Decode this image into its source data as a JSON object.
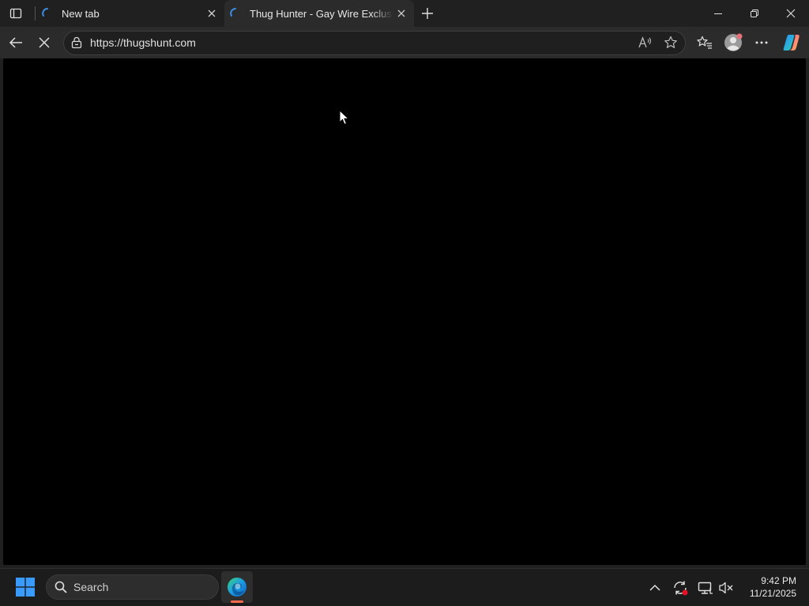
{
  "browser": {
    "tabs": [
      {
        "label": "New tab",
        "state": "loading"
      },
      {
        "label": "Thug Hunter - Gay Wire Exclusive",
        "state": "loading",
        "active": true
      }
    ],
    "address_bar": {
      "url": "https://thugshunt.com"
    },
    "icons": {
      "tab_actions": "tab-actions-icon",
      "back": "back-arrow-icon",
      "stop": "stop-loading-icon",
      "lock": "lock-icon",
      "read_aloud": "read-aloud-icon",
      "favorite": "star-icon",
      "favorites": "favorites-icon",
      "profile": "profile-avatar-icon",
      "more": "more-dots-icon",
      "copilot": "copilot-icon"
    },
    "content": {
      "background": "#000000"
    }
  },
  "taskbar": {
    "search_placeholder": "Search",
    "clock": {
      "time": "9:42 PM",
      "date": "11/21/2025"
    },
    "accent_colors": {
      "start": "#3a9bff",
      "edge_indicator": "#ff6a4d",
      "notification_dot": "#e81123"
    }
  }
}
